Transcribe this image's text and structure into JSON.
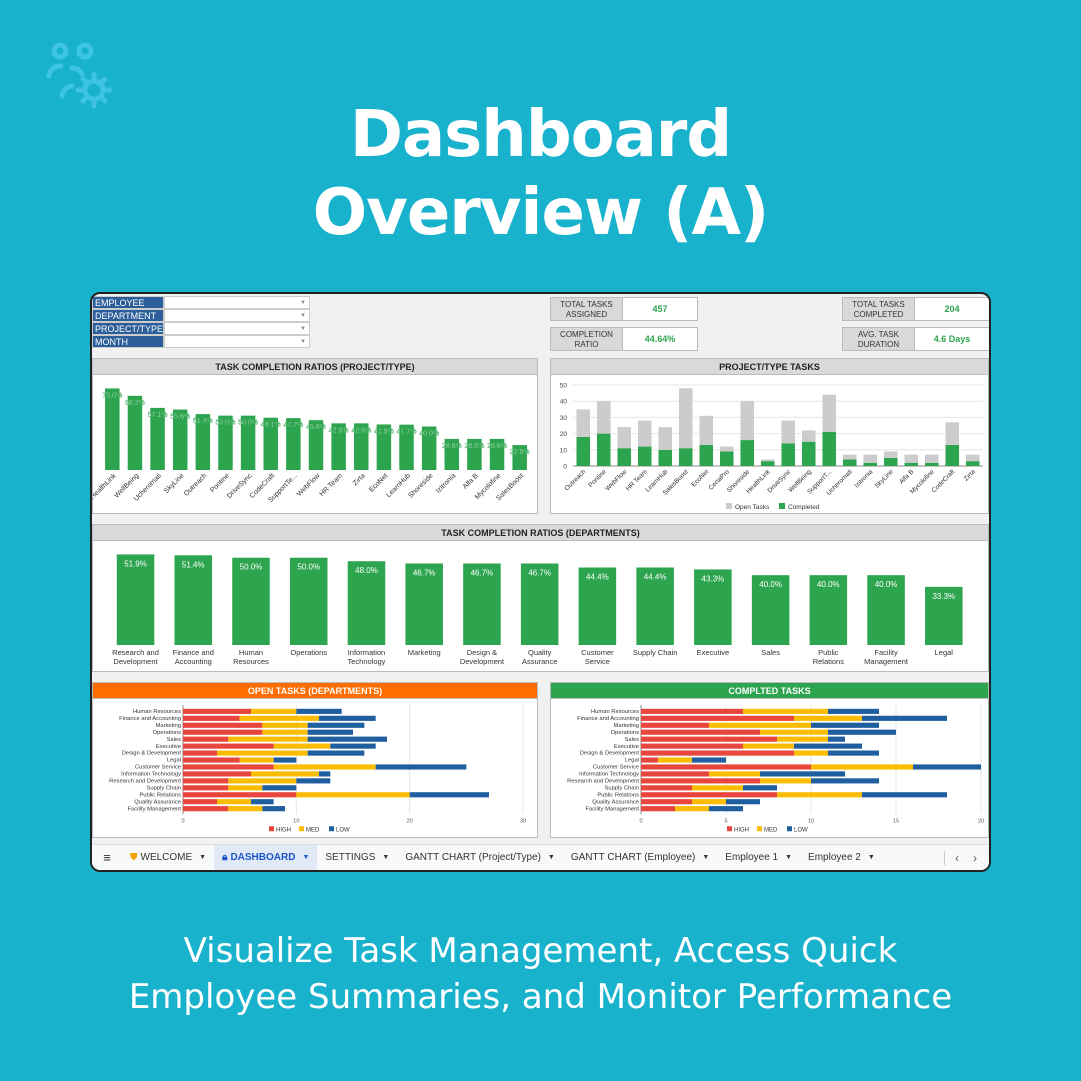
{
  "page": {
    "title_line1": "Dashboard",
    "title_line2": "Overview  (A)",
    "subtitle_line1": "Visualize Task Management, Access Quick",
    "subtitle_line2": "Employee Summaries, and Monitor Performance",
    "logo_icon": "team-settings-icon",
    "colors": {
      "background": "#19b2cd",
      "green": "#2da44e",
      "orange": "#ff6d00",
      "high": "#e8453c",
      "med": "#fbbc04",
      "low": "#1f5fa0",
      "open": "#cccccc"
    }
  },
  "filters": [
    {
      "label": "EMPLOYEE",
      "value": ""
    },
    {
      "label": "DEPARTMENT",
      "value": ""
    },
    {
      "label": "PROJECT/TYPE",
      "value": ""
    },
    {
      "label": "MONTH",
      "value": ""
    }
  ],
  "kpis": {
    "assigned": {
      "label": "TOTAL TASKS ASSIGNED",
      "value": "457"
    },
    "completed": {
      "label": "TOTAL TASKS COMPLETED",
      "value": "204"
    },
    "ratio": {
      "label": "COMPLETION RATIO",
      "value": "44.64%"
    },
    "duration": {
      "label": "AVG. TASK DURATION",
      "value": "4.6 Days"
    }
  },
  "panels": {
    "ratios_project": "TASK COMPLETION RATIOS (PROJECT/TYPE)",
    "project_tasks": "PROJECT/TYPE TASKS",
    "ratios_departments": "TASK COMPLETION RATIOS (DEPARTMENTS)",
    "open_tasks": "OPEN TASKS (DEPARTMENTS)",
    "completed_tasks": "COMPLTED TASKS"
  },
  "chart_data": [
    {
      "id": "ratios_project",
      "type": "bar",
      "title": "TASK COMPLETION RATIOS (PROJECT/TYPE)",
      "categories": [
        "HealthLink",
        "WellBeing",
        "Ucheromati",
        "SkyLine",
        "Outreach",
        "Pontine",
        "DriveSync",
        "CodeCraft",
        "SupportTe...",
        "WebFlow",
        "HR Team",
        "Zirta",
        "EcoNet",
        "LearnHub",
        "Shoreside",
        "Izitronia",
        "Alfa B",
        "Mycolofine",
        "SalesBoost"
      ],
      "values": [
        75.0,
        68.2,
        57.1,
        55.6,
        51.4,
        50.0,
        50.0,
        48.1,
        47.7,
        45.8,
        42.9,
        42.9,
        41.9,
        41.7,
        40.0,
        28.6,
        28.6,
        28.6,
        22.9
      ],
      "value_suffix": "%",
      "ylim": [
        0,
        80
      ]
    },
    {
      "id": "project_tasks",
      "type": "bar",
      "stacked": true,
      "title": "PROJECT/TYPE TASKS",
      "categories": [
        "Outreach",
        "Pontine",
        "WebFlow",
        "HR Team",
        "LearnHub",
        "SalesBoost",
        "EcoNet",
        "CertaPro",
        "Shoreside",
        "HealthLink",
        "DriveSync",
        "WellBeing",
        "SupportT...",
        "Ucheromati",
        "Izitronia",
        "SkyLine",
        "Alfa B",
        "Mycolofine",
        "CodeCraft",
        "Zirta"
      ],
      "series": [
        {
          "name": "Completed",
          "values": [
            18,
            20,
            11,
            12,
            10,
            11,
            13,
            9,
            16,
            3,
            14,
            15,
            21,
            4,
            2,
            5,
            2,
            2,
            13,
            3
          ]
        },
        {
          "name": "Open Tasks",
          "values": [
            17,
            20,
            13,
            16,
            14,
            37,
            18,
            3,
            24,
            1,
            14,
            7,
            23,
            3,
            5,
            4,
            5,
            5,
            14,
            4
          ]
        }
      ],
      "yticks": [
        0,
        10,
        20,
        30,
        40,
        50
      ],
      "ylim": [
        0,
        50
      ],
      "legend": [
        "Open Tasks",
        "Completed"
      ],
      "legend_position": "bottom"
    },
    {
      "id": "ratios_departments",
      "type": "bar",
      "title": "TASK COMPLETION RATIOS (DEPARTMENTS)",
      "categories": [
        "Research and Development",
        "Finance and Accounting",
        "Human Resources",
        "Operations",
        "Information Technology",
        "Marketing",
        "Design & Development",
        "Quality Assurance",
        "Customer Service",
        "Supply Chain",
        "Executive",
        "Sales",
        "Public Relations",
        "Facility Management",
        "Legal"
      ],
      "values": [
        51.9,
        51.4,
        50.0,
        50.0,
        48.0,
        46.7,
        46.7,
        46.7,
        44.4,
        44.4,
        43.3,
        40.0,
        40.0,
        40.0,
        33.3
      ],
      "value_suffix": "%",
      "ylim": [
        0,
        55
      ]
    },
    {
      "id": "open_tasks",
      "type": "bar",
      "orientation": "horizontal",
      "stacked": true,
      "title": "OPEN TASKS (DEPARTMENTS)",
      "categories": [
        "Human Resources",
        "Finance and Accounting",
        "Marketing",
        "Operations",
        "Sales",
        "Executive",
        "Design & Development",
        "Legal",
        "Customer Service",
        "Information Technology",
        "Research and Development",
        "Supply Chain",
        "Public Relations",
        "Quality Assurance",
        "Facility Management"
      ],
      "series": [
        {
          "name": "HIGH",
          "values": [
            6,
            5,
            7,
            7,
            4,
            8,
            3,
            5,
            8,
            6,
            4,
            4,
            10,
            3,
            4
          ]
        },
        {
          "name": "MED",
          "values": [
            4,
            7,
            4,
            4,
            7,
            5,
            8,
            3,
            9,
            6,
            6,
            3,
            10,
            3,
            3
          ]
        },
        {
          "name": "LOW",
          "values": [
            4,
            5,
            5,
            4,
            7,
            4,
            5,
            2,
            8,
            1,
            3,
            3,
            7,
            2,
            2
          ]
        }
      ],
      "xticks": [
        0,
        10,
        20,
        30
      ],
      "xlim": [
        0,
        30
      ],
      "legend_position": "bottom"
    },
    {
      "id": "completed_tasks",
      "type": "bar",
      "orientation": "horizontal",
      "stacked": true,
      "title": "COMPLTED TASKS",
      "categories": [
        "Human Resources",
        "Finance and Accounting",
        "Marketing",
        "Operations",
        "Sales",
        "Executive",
        "Design & Development",
        "Legal",
        "Customer Service",
        "Information Technology",
        "Research and Development",
        "Supply Chain",
        "Public Relations",
        "Quality Assurance",
        "Facility Management"
      ],
      "series": [
        {
          "name": "HIGH",
          "values": [
            6,
            9,
            4,
            7,
            8,
            6,
            9,
            1,
            10,
            4,
            7,
            3,
            8,
            3,
            2
          ]
        },
        {
          "name": "MED",
          "values": [
            5,
            4,
            6,
            4,
            3,
            3,
            2,
            2,
            6,
            3,
            3,
            3,
            5,
            2,
            2
          ]
        },
        {
          "name": "LOW",
          "values": [
            3,
            5,
            4,
            4,
            1,
            4,
            3,
            2,
            4,
            5,
            4,
            2,
            5,
            2,
            2
          ]
        }
      ],
      "xticks": [
        0,
        5,
        10,
        15,
        20
      ],
      "xlim": [
        0,
        20
      ],
      "legend_position": "bottom"
    }
  ],
  "tabs": {
    "menu_icon": "hamburger-menu-icon",
    "items": [
      {
        "label": "WELCOME",
        "icon": "shield-icon",
        "active": false
      },
      {
        "label": "DASHBOARD",
        "icon": "lock-icon",
        "active": true
      },
      {
        "label": "SETTINGS",
        "active": false
      },
      {
        "label": "GANTT CHART (Project/Type)",
        "active": false
      },
      {
        "label": "GANTT CHART (Employee)",
        "active": false
      },
      {
        "label": "Employee 1",
        "active": false
      },
      {
        "label": "Employee 2",
        "active": false
      }
    ],
    "prev_icon": "chevron-left-icon",
    "next_icon": "chevron-right-icon"
  }
}
